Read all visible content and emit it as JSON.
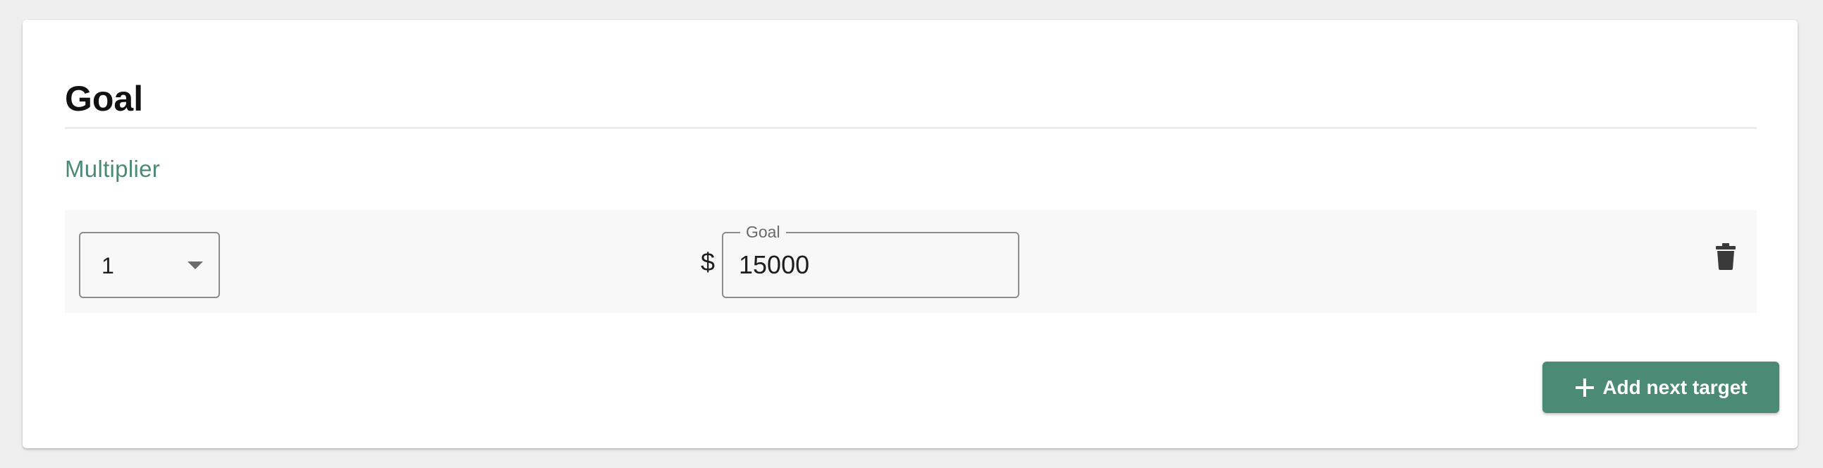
{
  "card": {
    "title": "Goal",
    "section_label": "Multiplier"
  },
  "target_row": {
    "multiplier_select": {
      "selected_value": "1"
    },
    "currency_symbol": "$",
    "goal_field": {
      "label": "Goal",
      "value": "15000"
    },
    "delete_icon": "trash-icon"
  },
  "actions": {
    "add_next_target_label": "Add next target",
    "add_icon": "plus-icon"
  },
  "colors": {
    "accent": "#4b8a74",
    "background": "#efefef",
    "card": "#ffffff",
    "row_background": "#f8f8f8"
  }
}
